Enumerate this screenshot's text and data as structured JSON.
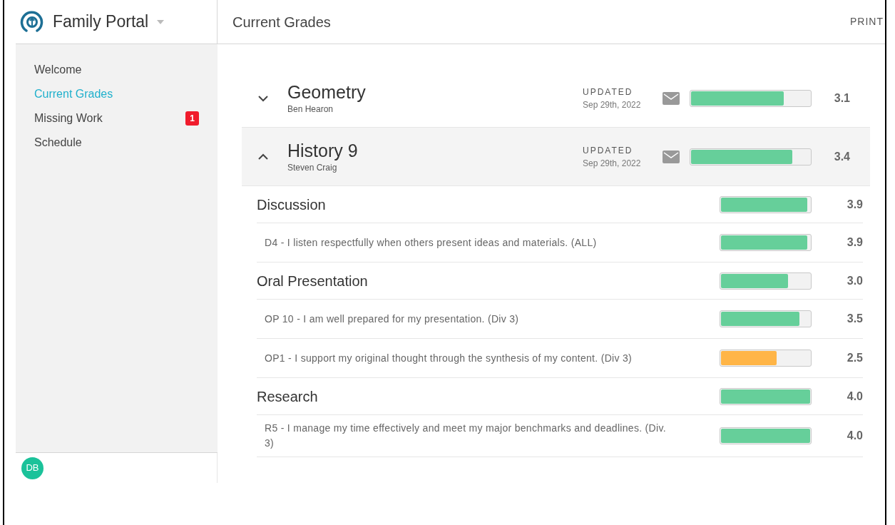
{
  "app": {
    "title": "Family Portal"
  },
  "sidebar": {
    "items": [
      {
        "label": "Welcome",
        "selected": false
      },
      {
        "label": "Current Grades",
        "selected": true
      },
      {
        "label": "Missing Work",
        "selected": false,
        "badge": "1"
      },
      {
        "label": "Schedule",
        "selected": false
      }
    ],
    "user_initials": "DB"
  },
  "page": {
    "title": "Current Grades",
    "action": "PRINT"
  },
  "courses": [
    {
      "name": "Geometry",
      "teacher": "Ben Hearon",
      "updated_label": "UPDATED",
      "updated_date": "Sep 29th, 2022",
      "level": 0.78,
      "score": "3.1",
      "color": "#66cf9a",
      "expanded": false
    },
    {
      "name": "History 9",
      "teacher": "Steven Craig",
      "updated_label": "UPDATED",
      "updated_date": "Sep 29th, 2022",
      "level": 0.85,
      "score": "3.4",
      "color": "#66cf9a",
      "expanded": true,
      "categories": [
        {
          "name": "Discussion",
          "level": 0.97,
          "score": "3.9",
          "color": "#66cf9a",
          "standards": [
            {
              "text": "D4 - I listen respectfully when others present ideas and materials. (ALL)",
              "level": 0.97,
              "score": "3.9",
              "color": "#66cf9a"
            }
          ]
        },
        {
          "name": "Oral Presentation",
          "level": 0.75,
          "score": "3.0",
          "color": "#66cf9a",
          "standards": [
            {
              "text": "OP 10 - I am well prepared for my presentation. (Div 3)",
              "level": 0.88,
              "score": "3.5",
              "color": "#66cf9a"
            },
            {
              "text": "OP1 - I support my original thought through the synthesis of my content. (Div 3)",
              "level": 0.62,
              "score": "2.5",
              "color": "#ffb547"
            }
          ]
        },
        {
          "name": "Research",
          "level": 1.0,
          "score": "4.0",
          "color": "#66cf9a",
          "standards": [
            {
              "text": "R5 - I manage my time effectively and meet my major benchmarks and deadlines. (Div. 3)",
              "level": 1.0,
              "score": "4.0",
              "color": "#66cf9a"
            }
          ]
        }
      ]
    }
  ]
}
